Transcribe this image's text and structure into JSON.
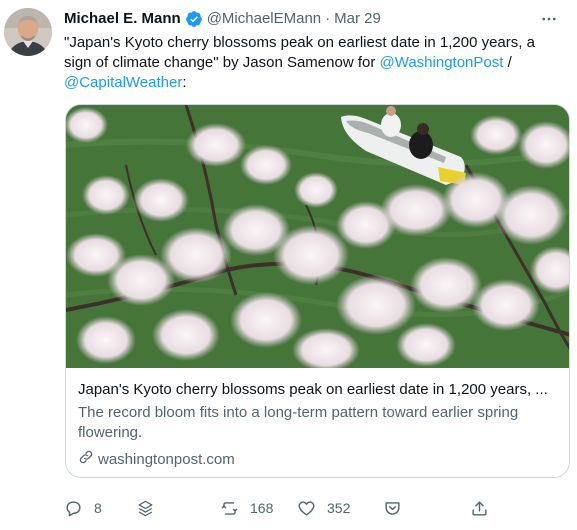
{
  "tweet": {
    "author_name": "Michael E. Mann",
    "handle": "@MichaelEMann",
    "separator": "·",
    "date": "Mar 29",
    "text_part1": "\"Japan's Kyoto cherry blossoms peak on earliest date in 1,200 years, a sign of climate change\" by Jason Samenow for ",
    "mention1": "@WashingtonPost",
    "text_part2": " / ",
    "mention2": "@CapitalWeather",
    "text_part3": ":"
  },
  "card": {
    "title": "Japan's Kyoto cherry blossoms peak on earliest date in 1,200 years, ...",
    "description": "The record bloom fits into a long-term pattern toward earlier spring flowering.",
    "domain": "washingtonpost.com"
  },
  "actions": {
    "reply_count": "8",
    "retweet_count": "168",
    "like_count": "352"
  },
  "colors": {
    "link": "#1d9bf0",
    "secondary_text": "#536471",
    "verified_badge": "#1d9bf0",
    "card_border": "#cfd9de"
  },
  "icons": [
    "more-icon",
    "verified-icon",
    "link-icon",
    "reply-icon",
    "layers-icon",
    "retweet-icon",
    "like-icon",
    "mute-icon",
    "share-icon"
  ]
}
